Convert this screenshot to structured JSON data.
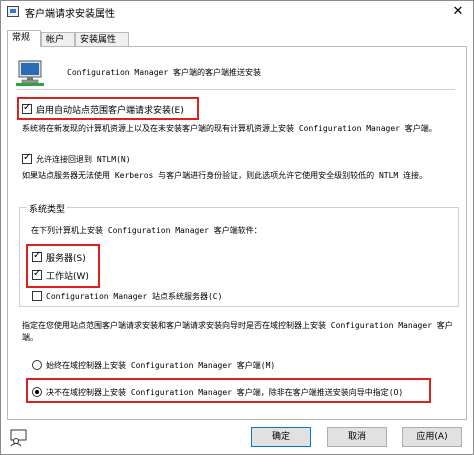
{
  "window": {
    "title": "客户端请求安装属性",
    "close_glyph": "✕"
  },
  "tabs": [
    {
      "label": "常规",
      "active": true
    },
    {
      "label": "帐户",
      "active": false
    },
    {
      "label": "安装属性",
      "active": false
    }
  ],
  "header": {
    "description": "Configuration Manager 客户端的客户端推送安装"
  },
  "auto_install": {
    "checkbox_label": "启用自动站点范围客户端请求安装(E)",
    "checked": true,
    "description": "系统将在新发现的计算机资源上以及在未安装客户端的现有计算机资源上安装 Configuration Manager 客户端。"
  },
  "ntlm": {
    "checkbox_label": "允许连接回退到 NTLM(N)",
    "checked": true,
    "description": "如果站点服务器无法使用 Kerberos 与客户端进行身份验证，则此选项允许它使用安全级别较低的 NTLM 连接。"
  },
  "system_types": {
    "legend": "系统类型",
    "intro": "在下列计算机上安装 Configuration Manager 客户端软件：",
    "items": [
      {
        "label": "服务器(S)",
        "checked": true
      },
      {
        "label": "工作站(W)",
        "checked": true
      },
      {
        "label": "Configuration Manager 站点系统服务器(C)",
        "checked": false
      }
    ]
  },
  "domain_controllers": {
    "question": "指定在您使用站点范围客户端请求安装和客户端请求安装向导时是否在域控制器上安装 Configuration Manager 客户端。",
    "options": [
      {
        "label": "始终在域控制器上安装 Configuration Manager 客户端(M)",
        "selected": false
      },
      {
        "label": "决不在域控制器上安装 Configuration Manager 客户端，除非在客户端推送安装向导中指定(O)",
        "selected": true
      }
    ]
  },
  "buttons": {
    "ok": "确定",
    "cancel": "取消",
    "apply": "应用(A)"
  },
  "colors": {
    "highlight": "#e0201a",
    "accent": "#0078d7"
  }
}
